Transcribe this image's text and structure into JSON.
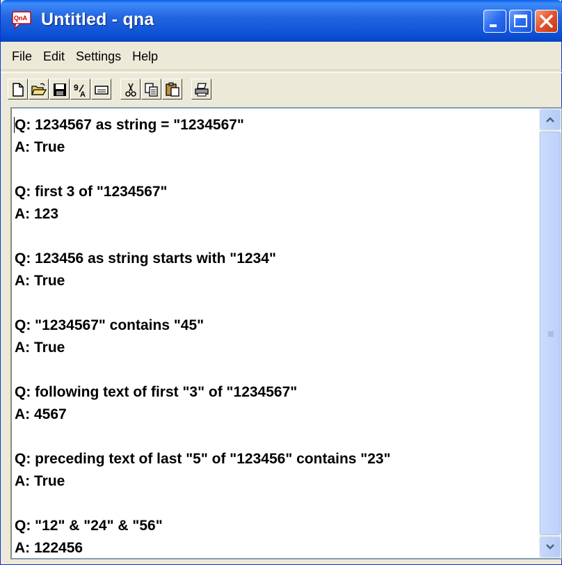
{
  "window": {
    "title": "Untitled - qna",
    "app_icon_text": "QnA"
  },
  "menu": [
    "File",
    "Edit",
    "Settings",
    "Help"
  ],
  "toolbar": [
    "new-file-icon",
    "open-folder-icon",
    "save-icon",
    "font-icon",
    "window-icon",
    "cut-icon",
    "copy-icon",
    "paste-icon",
    "print-icon"
  ],
  "document": {
    "lines": [
      "Q: 1234567 as string = \"1234567\"",
      "A: True",
      "",
      "Q: first 3 of \"1234567\"",
      "A: 123",
      "",
      "Q: 123456 as string starts with \"1234\"",
      "A: True",
      "",
      "Q: \"1234567\" contains \"45\"",
      "A: True",
      "",
      "Q: following text of first \"3\" of \"1234567\"",
      "A: 4567",
      "",
      "Q: preceding text of last \"5\" of \"123456\" contains \"23\"",
      "A: True",
      "",
      "Q: \"12\" & \"24\" & \"56\"",
      "A: 122456"
    ]
  }
}
